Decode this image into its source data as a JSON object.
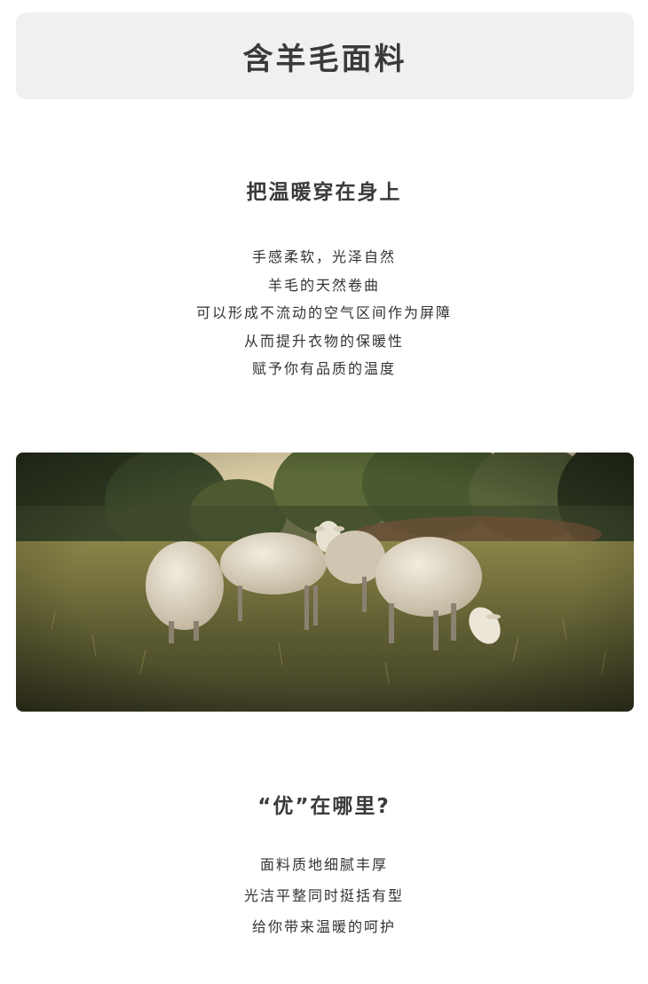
{
  "banner": {
    "title": "含羊毛面料"
  },
  "section_warmth": {
    "heading": "把温暖穿在身上",
    "lines": [
      "手感柔软，光泽自然",
      "羊毛的天然卷曲",
      "可以形成不流动的空气区间作为屏障",
      "从而提升衣物的保暖性",
      "赋予你有品质的温度"
    ]
  },
  "photo": {
    "subject": "sheep-grazing-meadow-photo",
    "colors": {
      "sky": "#d9c9a0",
      "trees": "#3f4a2c",
      "grass": "#6b6a3a",
      "wool": "#e8e0cf"
    }
  },
  "section_advantage": {
    "heading": "“优”在哪里?",
    "lines": [
      "面料质地细腻丰厚",
      "光洁平整同时挺括有型",
      "给你带来温暖的呵护"
    ]
  }
}
